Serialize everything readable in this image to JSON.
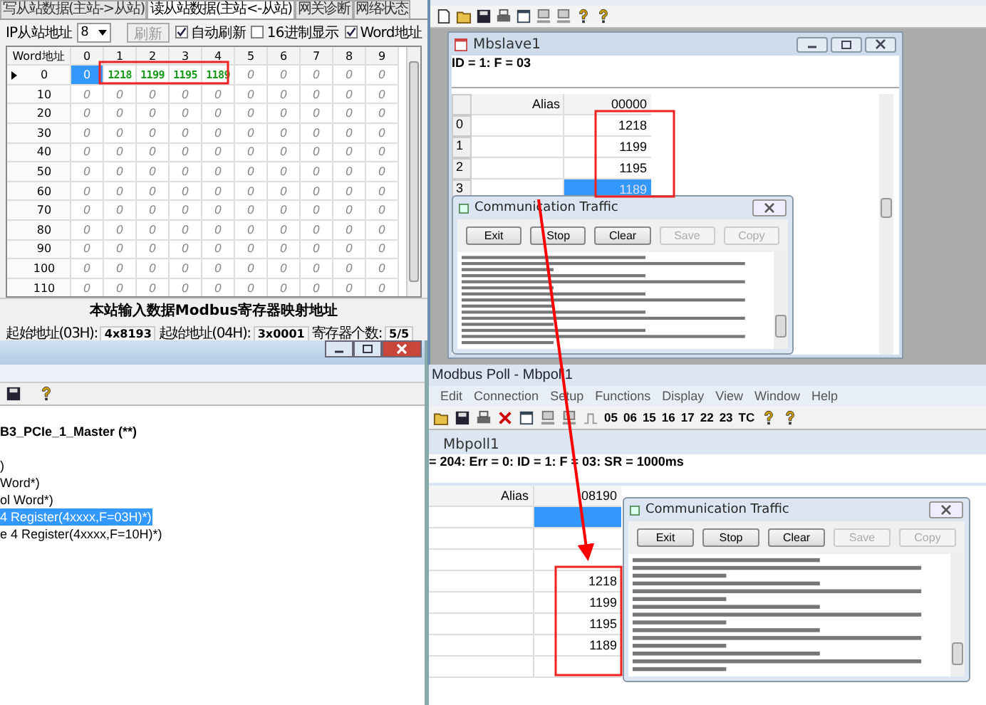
{
  "gateway_panel": {
    "tabs": [
      {
        "label": "写从站数据(主站->从站)",
        "selected": false
      },
      {
        "label": "读从站数据(主站<-从站)",
        "selected": true
      },
      {
        "label": "网关诊断",
        "selected": false
      },
      {
        "label": "网络状态",
        "selected": false
      }
    ],
    "toolbar": {
      "slave_address_label": "IP从站地址",
      "slave_address_value": "8",
      "refresh_button": {
        "label": "刷新",
        "disabled": true
      },
      "checkboxes": [
        {
          "label": "自动刷新",
          "checked": true
        },
        {
          "label": "16进制显示",
          "checked": false
        },
        {
          "label": "Word地址",
          "checked": true
        }
      ]
    },
    "grid": {
      "corner": "Word地址",
      "columns": [
        "0",
        "1",
        "2",
        "3",
        "4",
        "5",
        "6",
        "7",
        "8",
        "9"
      ],
      "rows": [
        {
          "address": "0",
          "current": true,
          "cells": [
            {
              "value": "0",
              "kind": "selected"
            },
            {
              "value": "1218",
              "kind": "received"
            },
            {
              "value": "1199",
              "kind": "received"
            },
            {
              "value": "1195",
              "kind": "received"
            },
            {
              "value": "1189",
              "kind": "received"
            },
            {
              "value": "0",
              "kind": "idle"
            },
            {
              "value": "0",
              "kind": "idle"
            },
            {
              "value": "0",
              "kind": "idle"
            },
            {
              "value": "0",
              "kind": "idle"
            },
            {
              "value": "0",
              "kind": "idle"
            }
          ]
        },
        {
          "address": "10",
          "current": false,
          "cells": [
            "0",
            "0",
            "0",
            "0",
            "0",
            "0",
            "0",
            "0",
            "0",
            "0"
          ]
        },
        {
          "address": "20",
          "current": false,
          "cells": [
            "0",
            "0",
            "0",
            "0",
            "0",
            "0",
            "0",
            "0",
            "0",
            "0"
          ]
        },
        {
          "address": "30",
          "current": false,
          "cells": [
            "0",
            "0",
            "0",
            "0",
            "0",
            "0",
            "0",
            "0",
            "0",
            "0"
          ]
        },
        {
          "address": "40",
          "current": false,
          "cells": [
            "0",
            "0",
            "0",
            "0",
            "0",
            "0",
            "0",
            "0",
            "0",
            "0"
          ]
        },
        {
          "address": "50",
          "current": false,
          "cells": [
            "0",
            "0",
            "0",
            "0",
            "0",
            "0",
            "0",
            "0",
            "0",
            "0"
          ]
        },
        {
          "address": "60",
          "current": false,
          "cells": [
            "0",
            "0",
            "0",
            "0",
            "0",
            "0",
            "0",
            "0",
            "0",
            "0"
          ]
        },
        {
          "address": "70",
          "current": false,
          "cells": [
            "0",
            "0",
            "0",
            "0",
            "0",
            "0",
            "0",
            "0",
            "0",
            "0"
          ]
        },
        {
          "address": "80",
          "current": false,
          "cells": [
            "0",
            "0",
            "0",
            "0",
            "0",
            "0",
            "0",
            "0",
            "0",
            "0"
          ]
        },
        {
          "address": "90",
          "current": false,
          "cells": [
            "0",
            "0",
            "0",
            "0",
            "0",
            "0",
            "0",
            "0",
            "0",
            "0"
          ]
        },
        {
          "address": "100",
          "current": false,
          "cells": [
            "0",
            "0",
            "0",
            "0",
            "0",
            "0",
            "0",
            "0",
            "0",
            "0"
          ]
        },
        {
          "address": "110",
          "current": false,
          "cells": [
            "0",
            "0",
            "0",
            "0",
            "0",
            "0",
            "0",
            "0",
            "0",
            "0"
          ]
        }
      ]
    },
    "footer": {
      "title": "本站输入数据Modbus寄存器映射地址",
      "fields": [
        {
          "label": "起始地址(03H):",
          "value": "4x8193"
        },
        {
          "label": "起始地址(04H):",
          "value": "3x0001"
        },
        {
          "label": "寄存器个数:",
          "value": "5/5"
        }
      ]
    }
  },
  "project_window": {
    "tree": [
      {
        "label": "B3_PCIe_1_Master (**)",
        "bold": true,
        "selected": false
      },
      {
        "label": ")",
        "bold": false,
        "selected": false
      },
      {
        "label": "Word*)",
        "bold": false,
        "selected": false
      },
      {
        "label": "ol Word*)",
        "bold": false,
        "selected": false
      },
      {
        "label": "4 Register(4xxxx,F=03H)*)",
        "bold": false,
        "selected": true
      },
      {
        "label": "e 4 Register(4xxxx,F=10H)*)",
        "bold": false,
        "selected": false
      }
    ]
  },
  "modbus_slave": {
    "child": {
      "title": "Mbslave1",
      "status": "ID = 1: F = 03",
      "columns": [
        "Alias",
        "00000"
      ],
      "rows": [
        {
          "index": "0",
          "value": "1218",
          "selected": false
        },
        {
          "index": "1",
          "value": "1199",
          "selected": false
        },
        {
          "index": "2",
          "value": "1195",
          "selected": false
        },
        {
          "index": "3",
          "value": "1189",
          "selected": true
        }
      ]
    },
    "traffic": {
      "title": "Communication Traffic",
      "buttons": [
        {
          "label": "Exit",
          "disabled": false
        },
        {
          "label": "Stop",
          "disabled": false
        },
        {
          "label": "Clear",
          "disabled": false
        },
        {
          "label": "Save",
          "disabled": true
        },
        {
          "label": "Copy",
          "disabled": true
        }
      ]
    }
  },
  "modbus_poll": {
    "title": "Modbus Poll - Mbpoll1",
    "menu": [
      "Edit",
      "Connection",
      "Setup",
      "Functions",
      "Display",
      "View",
      "Window",
      "Help"
    ],
    "function_codes": [
      "05",
      "06",
      "15",
      "16",
      "17",
      "22",
      "23",
      "TC"
    ],
    "child": {
      "title": "Mbpoll1",
      "status": "= 204: Err = 0: ID = 1: F = 03: SR = 1000ms",
      "columns": [
        "Alias",
        "08190"
      ],
      "rows": [
        {
          "value": "",
          "selected": true
        },
        {
          "value": "",
          "selected": false
        },
        {
          "value": "",
          "selected": false
        },
        {
          "value": "1218",
          "selected": false
        },
        {
          "value": "1199",
          "selected": false
        },
        {
          "value": "1195",
          "selected": false
        },
        {
          "value": "1189",
          "selected": false
        },
        {
          "value": "",
          "selected": false
        }
      ]
    },
    "traffic": {
      "title": "Communication Traffic",
      "buttons": [
        {
          "label": "Exit",
          "disabled": false
        },
        {
          "label": "Stop",
          "disabled": false
        },
        {
          "label": "Clear",
          "disabled": false
        },
        {
          "label": "Save",
          "disabled": true
        },
        {
          "label": "Copy",
          "disabled": true
        }
      ]
    }
  }
}
